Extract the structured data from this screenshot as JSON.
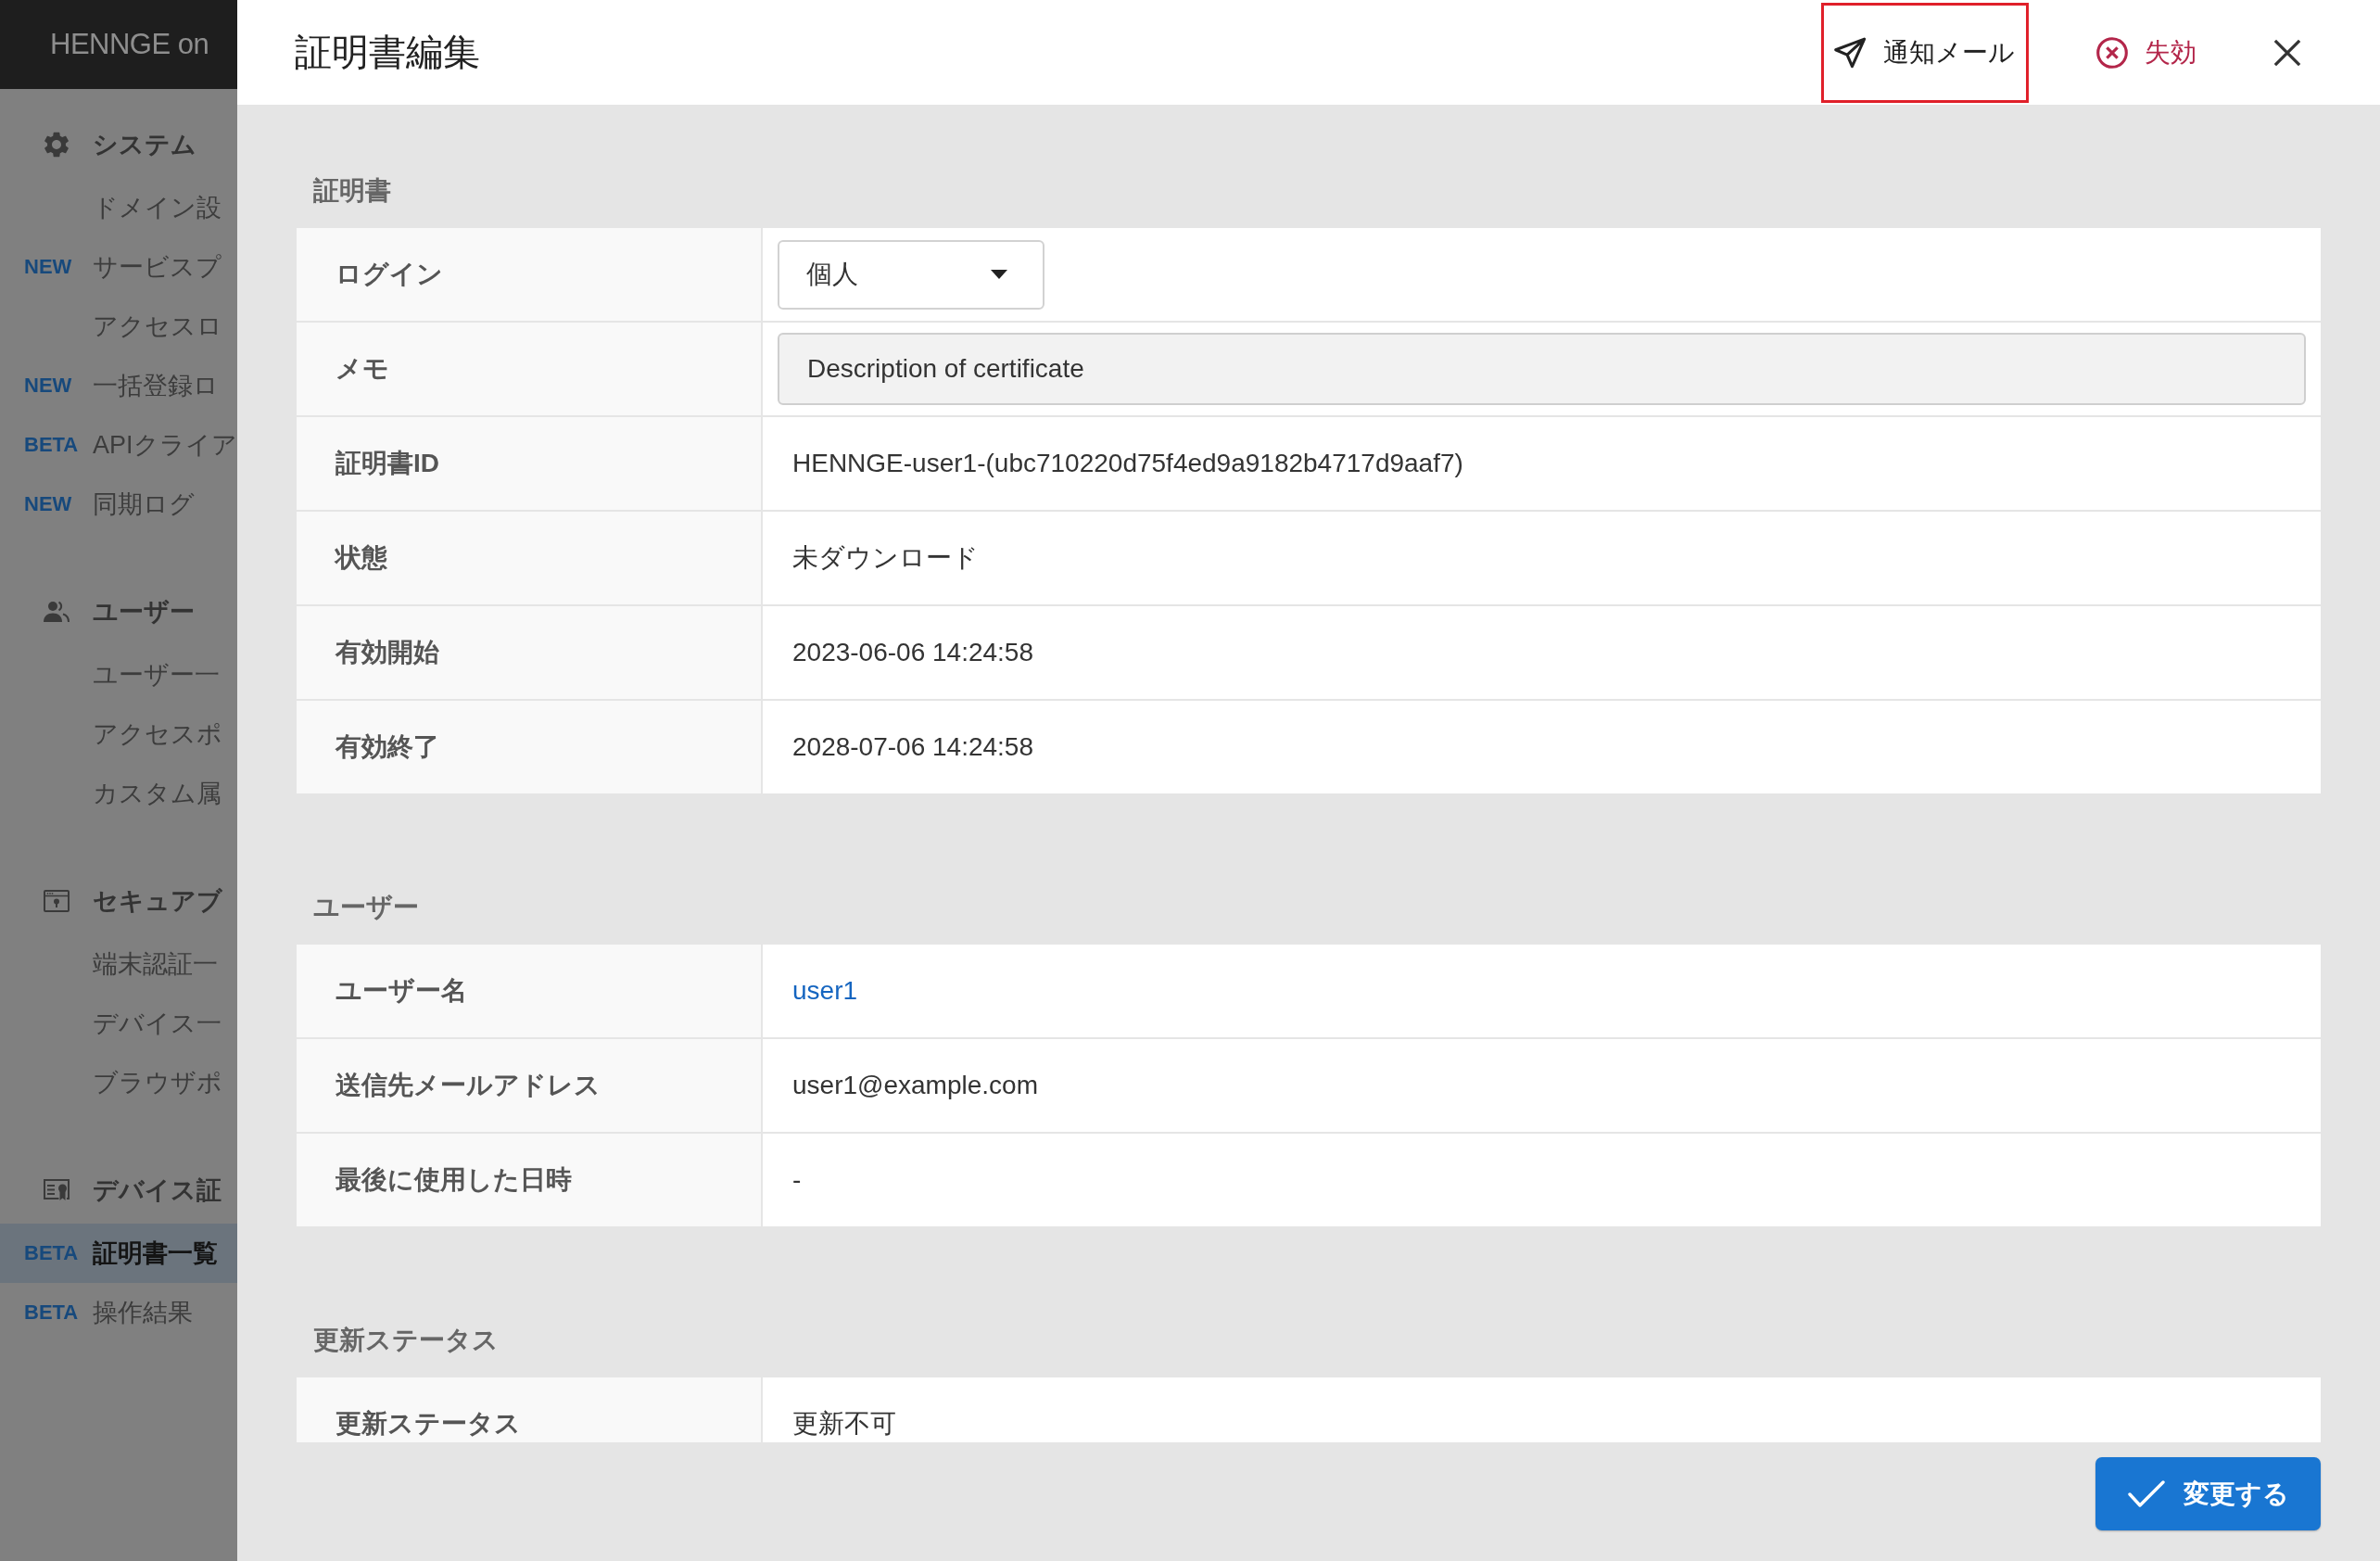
{
  "sidebar": {
    "logo": "HENNGE on",
    "groups": [
      {
        "title": "システム",
        "items": [
          {
            "label": "ドメイン設",
            "selected": false
          },
          {
            "badge": "NEW",
            "label": "サービスプ",
            "selected": false
          },
          {
            "label": "アクセスロ",
            "selected": false
          },
          {
            "badge": "NEW",
            "label": "一括登録ロ",
            "selected": false
          },
          {
            "badge": "BETA",
            "label": "APIクライア",
            "selected": false
          },
          {
            "badge": "NEW",
            "label": "同期ログ",
            "selected": false
          }
        ]
      },
      {
        "title": "ユーザー",
        "items": [
          {
            "label": "ユーザー一",
            "selected": false
          },
          {
            "label": "アクセスポ",
            "selected": false
          },
          {
            "label": "カスタム属",
            "selected": false
          }
        ]
      },
      {
        "title": "セキュアブ",
        "items": [
          {
            "label": "端末認証一",
            "selected": false
          },
          {
            "label": "デバイス一",
            "selected": false
          },
          {
            "label": "ブラウザポ",
            "selected": false
          }
        ]
      },
      {
        "title": "デバイス証",
        "items": [
          {
            "badge": "BETA",
            "label": "証明書一覧",
            "selected": true
          },
          {
            "badge": "BETA",
            "label": "操作結果",
            "selected": false
          }
        ]
      }
    ]
  },
  "dialog": {
    "title": "証明書編集",
    "actions": [
      {
        "kind": "notify",
        "label": "通知メール",
        "highlighted": true
      },
      {
        "kind": "revoke",
        "label": "失効",
        "highlighted": false
      }
    ],
    "sections": [
      {
        "title": "証明書",
        "rows": [
          {
            "label": "ログイン",
            "kind": "select",
            "value": "個人"
          },
          {
            "label": "メモ",
            "kind": "input",
            "value": "Description of certificate"
          },
          {
            "label": "証明書ID",
            "kind": "text",
            "value": "HENNGE-user1-(ubc710220d75f4ed9a9182b4717d9aaf7)"
          },
          {
            "label": "状態",
            "kind": "text",
            "value": "未ダウンロード"
          },
          {
            "label": "有効開始",
            "kind": "text",
            "value": "2023-06-06 14:24:58"
          },
          {
            "label": "有効終了",
            "kind": "text",
            "value": "2028-07-06 14:24:58"
          }
        ]
      },
      {
        "title": "ユーザー",
        "rows": [
          {
            "label": "ユーザー名",
            "kind": "link",
            "value": "user1"
          },
          {
            "label": "送信先メールアドレス",
            "kind": "text",
            "value": "user1@example.com"
          },
          {
            "label": "最後に使用した日時",
            "kind": "text",
            "value": "-"
          }
        ]
      },
      {
        "title": "更新ステータス",
        "rows": [
          {
            "label": "更新ステータス",
            "kind": "text",
            "value": "更新不可"
          }
        ]
      }
    ],
    "submit": {
      "label": "変更する"
    }
  }
}
